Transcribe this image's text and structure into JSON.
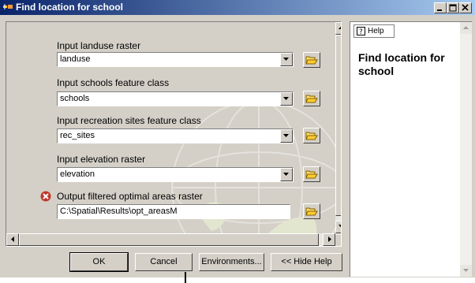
{
  "window": {
    "title": "Find location for school",
    "colors": {
      "titlebar_start": "#0a246a",
      "titlebar_end": "#a6caf0",
      "face": "#d4d0c8",
      "error": "#c0392b"
    }
  },
  "title_buttons": [
    {
      "name": "minimize-icon",
      "glyph": "_"
    },
    {
      "name": "maximize-icon",
      "glyph": "□"
    },
    {
      "name": "close-icon",
      "glyph": "x"
    }
  ],
  "params": [
    {
      "label": "Input landuse raster",
      "value": "landuse"
    },
    {
      "label": "Input schools feature class",
      "value": "schools"
    },
    {
      "label": "Input recreation sites feature class",
      "value": "rec_sites"
    },
    {
      "label": "Input elevation raster",
      "value": "elevation"
    },
    {
      "label": "Output filtered optimal areas raster",
      "value": "C:\\Spatial\\Results\\opt_areasM"
    }
  ],
  "buttons": {
    "ok": "OK",
    "cancel": "Cancel",
    "environments": "Environments...",
    "hide_help": "<< Hide Help"
  },
  "help": {
    "tab_label": "Help",
    "title": "Find location for school"
  }
}
